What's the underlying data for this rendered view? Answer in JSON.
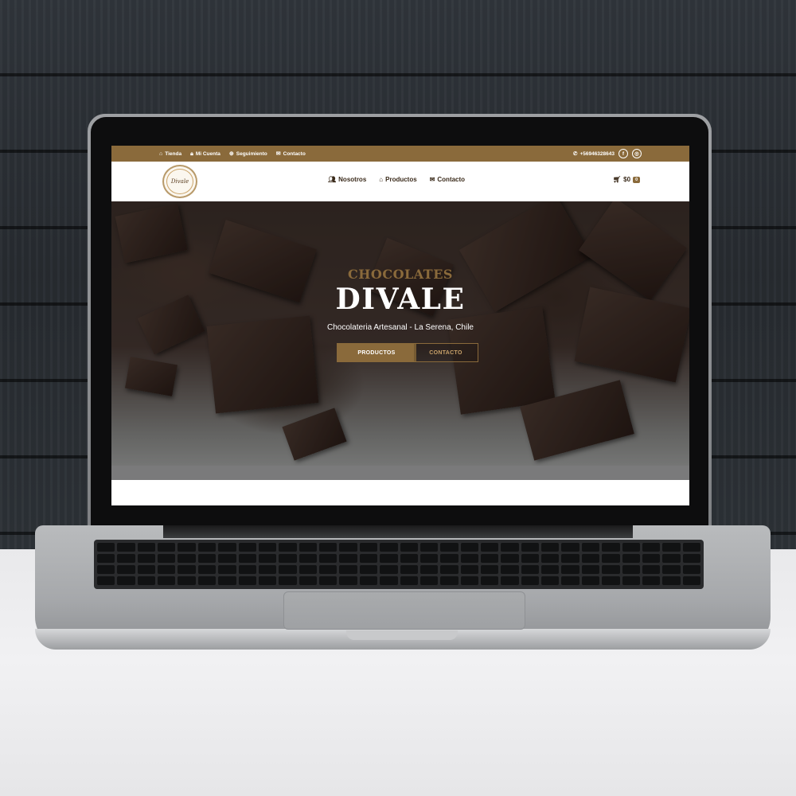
{
  "topbar": {
    "links": [
      {
        "icon": "store-icon",
        "label": "Tienda"
      },
      {
        "icon": "lock-icon",
        "label": "Mi Cuenta"
      },
      {
        "icon": "globe-icon",
        "label": "Seguimiento"
      },
      {
        "icon": "envelope-icon",
        "label": "Contacto"
      }
    ],
    "phone": "+56946328643",
    "social": [
      {
        "icon": "facebook-icon",
        "glyph": "f"
      },
      {
        "icon": "instagram-icon",
        "glyph": "◎"
      }
    ]
  },
  "navbar": {
    "logo_text": "Divale",
    "menu": [
      {
        "icon": "users-icon",
        "label": "Nosotros"
      },
      {
        "icon": "basket-icon",
        "label": "Productos"
      },
      {
        "icon": "envelope-icon",
        "label": "Contacto"
      }
    ],
    "cart_total": "$0",
    "cart_count": "0"
  },
  "hero": {
    "supertitle": "CHOCOLATES",
    "title": "DIVALE",
    "subtitle": "Chocolateria Artesanal - La Serena, Chile",
    "primary_button": "PRODUCTOS",
    "secondary_button": "CONTACTO"
  },
  "colors": {
    "brand": "#8a6a3b",
    "text_dark": "#3a2a1a"
  }
}
